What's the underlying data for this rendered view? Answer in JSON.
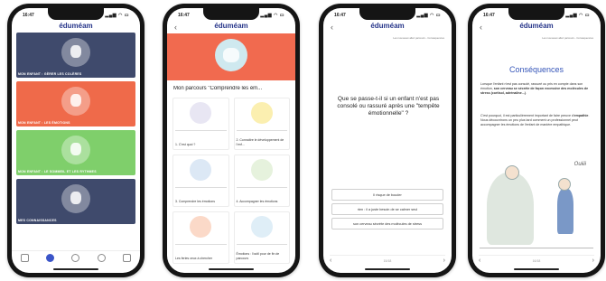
{
  "status": {
    "time": "16:47",
    "icons": "▂▄▆ ◠ ▭"
  },
  "brand": "éduméam",
  "screen1": {
    "categories": [
      {
        "label": "MON ENFANT : GÈRER LES COLÈRES",
        "color": "#3f4a6c"
      },
      {
        "label": "MON ENFANT : LES ÉMOTIONS",
        "color": "#ef6a4a"
      },
      {
        "label": "MON ENFANT : LE SOMMEIL ET LES RYTHMES",
        "color": "#7fcf6b"
      },
      {
        "label": "MES CONNAISSANCES",
        "color": "#3f4a6c"
      }
    ],
    "tabs": [
      "home-icon",
      "parcours-icon",
      "search-icon",
      "profile-icon",
      "grid-icon"
    ]
  },
  "screen2": {
    "title": "Mon parcours \"Comprendre les ém...",
    "modules": [
      {
        "label": "1. C'est quoi ?",
        "color": "#e8e6f3"
      },
      {
        "label": "2. Connaître le développement de l'enf...",
        "color": "#fbefb0"
      },
      {
        "label": "3. Comprendre les émotions",
        "color": "#dce8f5"
      },
      {
        "label": "4. Accompagner les émotions",
        "color": "#e6f2dd"
      },
      {
        "label": "Les feries ceux à chercher",
        "color": "#fbd9c8"
      },
      {
        "label": "Émotions : l'outil pour de fin de parcours",
        "color": "#dfeef7"
      }
    ]
  },
  "screen3": {
    "meta": "Les nouveaux allez parcours - Conséquences",
    "question": "Que se passe-t-il si un enfant n'est pas consolé ou rassuré après une \"tempête émotionnelle\" ?",
    "answers": [
      "Il risque de bouder",
      "rien : il a juste besoin de se calmer seul",
      "son cerveau sécrète des molécules de stress"
    ],
    "page": "15/18"
  },
  "screen4": {
    "meta": "Les nouveaux allez parcours - Conséquences",
    "title": "Conséquences",
    "para1_a": "Lorsque l'enfant n'est pas consolé, rassuré ou pris en compte dans son émotion, ",
    "para1_b": "son cerveau se sécrète de façon excessive des molécules de stress (cortisol, adrénaline...)",
    "para1_c": ".",
    "para2_a": "C'est pourquoi, il est particulièrement important de faire preuve d'",
    "para2_b": "empathie",
    "para2_c": ". Nous découvrirons un peu plus tard comment un professionnel peut accompagner les émotions de l'enfant de manière empathique.",
    "bubble": "Ouiiii",
    "page": "16/18"
  }
}
